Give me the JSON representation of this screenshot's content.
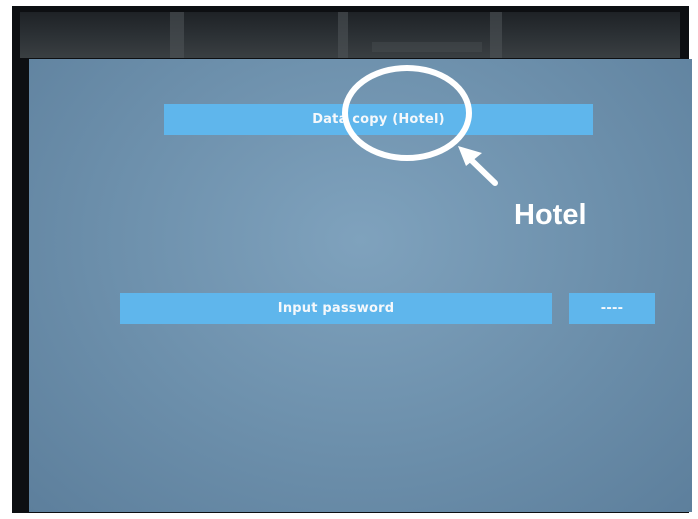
{
  "screen": {
    "title": "Data copy (Hotel)",
    "password_label": "Input password",
    "password_value": "----"
  },
  "annotation": {
    "label": "Hotel"
  },
  "colors": {
    "screen_bg": "#6c8fab",
    "bar_bg": "#5fb6ec",
    "bezel": "#0d0f12",
    "highlight": "#ffffff"
  },
  "icons": {
    "highlight_marker": "circle-highlight-icon",
    "pointer": "arrow-icon"
  }
}
